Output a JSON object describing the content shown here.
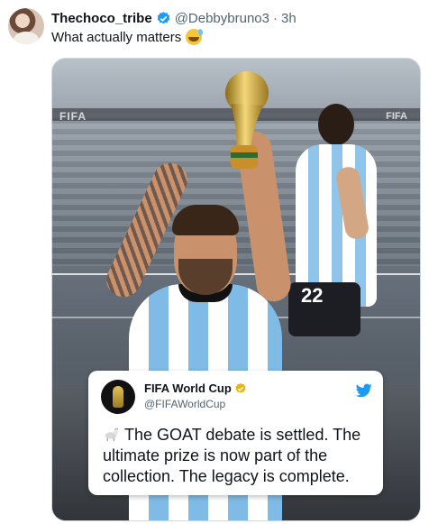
{
  "tweet": {
    "display_name": "Thechoco_tribe",
    "handle": "@Debbybruno3",
    "separator": "·",
    "time": "3h",
    "text": "What actually matters",
    "emoji": "sweat-smile-emoji"
  },
  "media": {
    "stadium_sign_left": "FIFA",
    "stadium_sign_right": "FIFA",
    "player_number": "22",
    "embedded_card": {
      "name": "FIFA World Cup",
      "handle": "@FIFAWorldCup",
      "text": "The GOAT debate is settled. The ultimate prize is now part of the collection. The legacy is complete.",
      "icons": [
        "goat-icon",
        "twitter-bird-icon",
        "verified-badge-gold"
      ]
    }
  },
  "colors": {
    "verified_blue": "#1d9bf0",
    "gold_badge": "#e2b719",
    "twitter_blue": "#1d9bf0",
    "secondary_text": "#536471"
  }
}
